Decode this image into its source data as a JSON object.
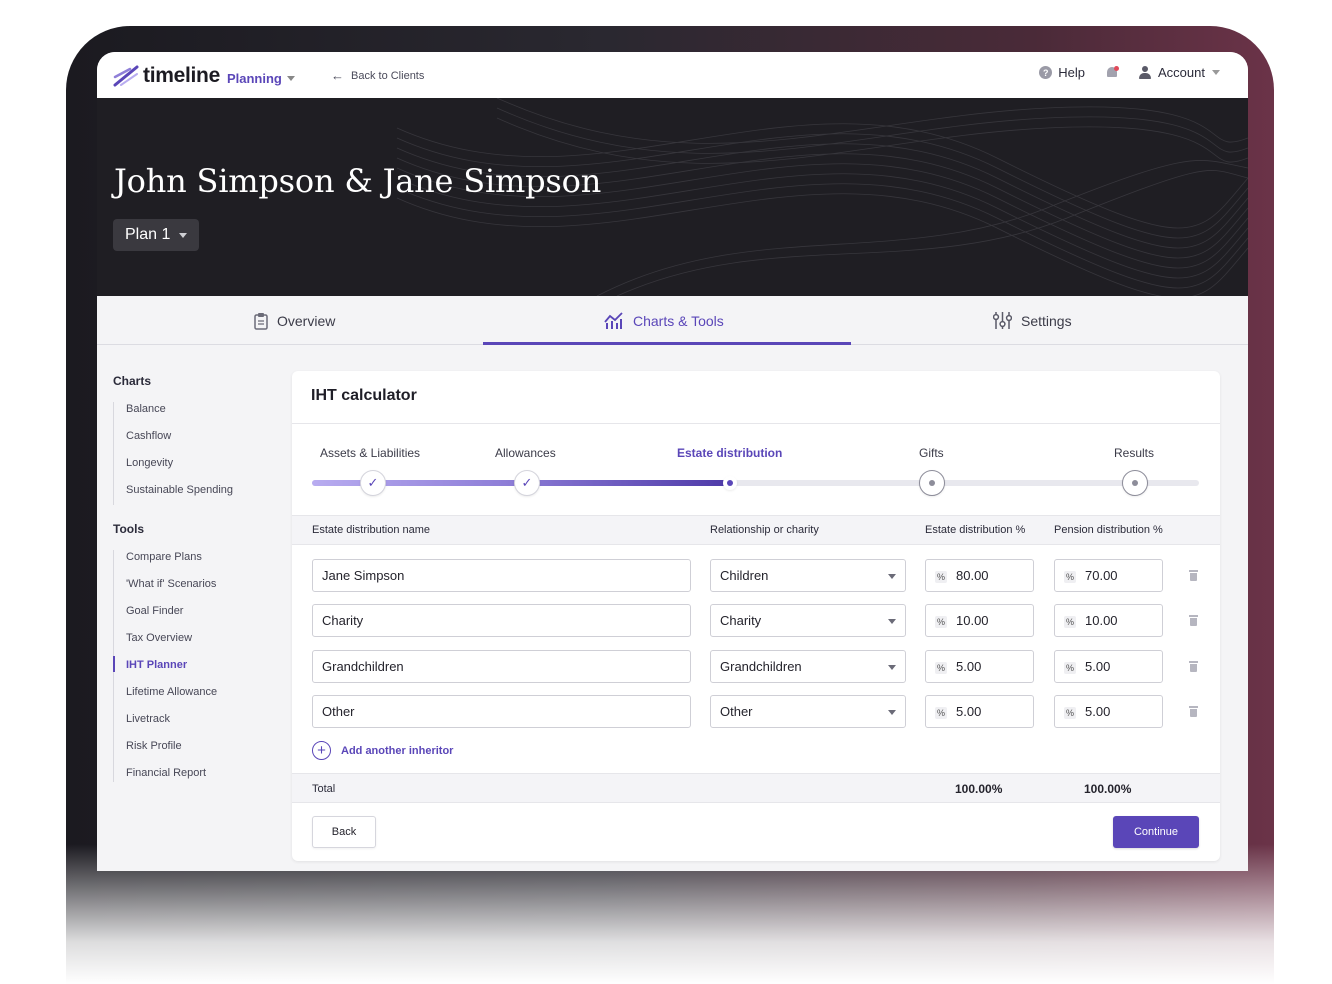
{
  "brand": {
    "name": "timeline",
    "product": "Planning",
    "accent": "#5a46b8"
  },
  "nav": {
    "back_label": "Back to Clients",
    "help_label": "Help",
    "account_label": "Account"
  },
  "hero": {
    "client_name": "John Simpson & Jane Simpson",
    "plan_label": "Plan 1"
  },
  "tabs": [
    {
      "label": "Overview",
      "icon": "clipboard-icon",
      "active": false
    },
    {
      "label": "Charts & Tools",
      "icon": "chart-icon",
      "active": true
    },
    {
      "label": "Settings",
      "icon": "sliders-icon",
      "active": false
    }
  ],
  "sidebar": {
    "charts_heading": "Charts",
    "charts": [
      "Balance",
      "Cashflow",
      "Longevity",
      "Sustainable Spending"
    ],
    "tools_heading": "Tools",
    "tools": [
      "Compare Plans",
      "'What if' Scenarios",
      "Goal Finder",
      "Tax Overview",
      "IHT Planner",
      "Lifetime Allowance",
      "Livetrack",
      "Risk Profile",
      "Financial Report"
    ],
    "active_tool": "IHT Planner"
  },
  "card": {
    "title": "IHT calculator",
    "steps": [
      {
        "label": "Assets & Liabilities",
        "state": "done"
      },
      {
        "label": "Allowances",
        "state": "done"
      },
      {
        "label": "Estate distribution",
        "state": "current"
      },
      {
        "label": "Gifts",
        "state": "upcoming"
      },
      {
        "label": "Results",
        "state": "upcoming"
      }
    ],
    "columns": {
      "name": "Estate distribution name",
      "relationship": "Relationship or charity",
      "estate_pct": "Estate distribution %",
      "pension_pct": "Pension distribution %"
    },
    "percent_symbol": "%",
    "rows": [
      {
        "name": "Jane Simpson",
        "relationship": "Children",
        "estate": "80.00",
        "pension": "70.00"
      },
      {
        "name": "Charity",
        "relationship": "Charity",
        "estate": "10.00",
        "pension": "10.00"
      },
      {
        "name": "Grandchildren",
        "relationship": "Grandchildren",
        "estate": "5.00",
        "pension": "5.00"
      },
      {
        "name": "Other",
        "relationship": "Other",
        "estate": "5.00",
        "pension": "5.00"
      }
    ],
    "add_label": "Add another inheritor",
    "total_label": "Total",
    "total_estate": "100.00%",
    "total_pension": "100.00%",
    "back_label": "Back",
    "continue_label": "Continue"
  }
}
